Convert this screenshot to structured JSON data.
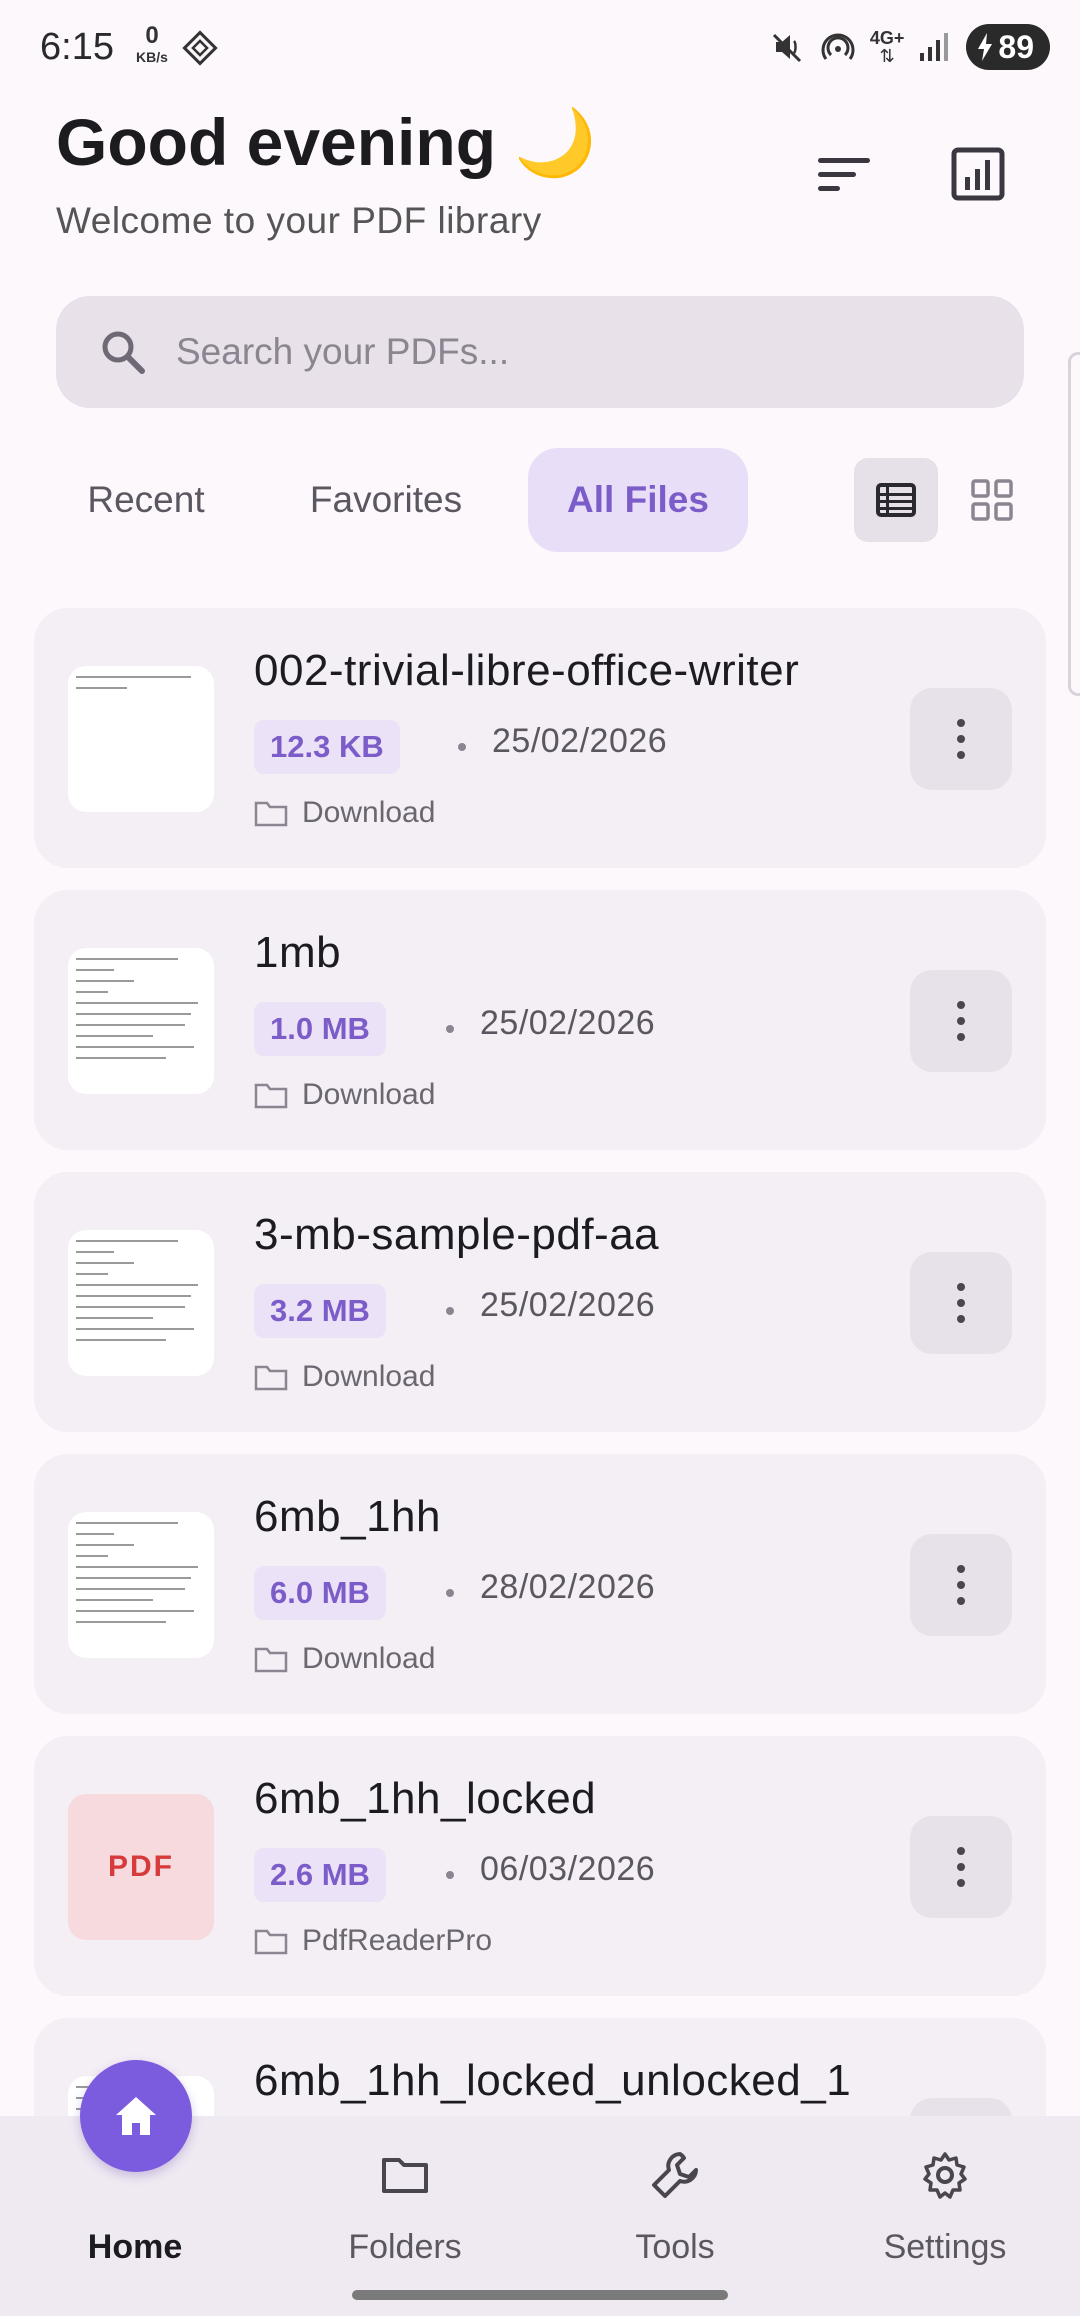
{
  "status_bar": {
    "time": "6:15",
    "net_speed_value": "0",
    "net_speed_unit": "KB/s",
    "network": "4G+",
    "battery": "89"
  },
  "header": {
    "greeting": "Good evening 🌙",
    "subtitle": "Welcome to your PDF library"
  },
  "search": {
    "placeholder": "Search your PDFs..."
  },
  "tabs": [
    {
      "label": "Recent"
    },
    {
      "label": "Favorites"
    },
    {
      "label": "All Files",
      "active": true
    }
  ],
  "files": [
    {
      "name": "002-trivial-libre-office-writer",
      "size": "12.3 KB",
      "date": "25/02/2026",
      "folder": "Download",
      "thumb": "blank"
    },
    {
      "name": "1mb",
      "size": "1.0 MB",
      "date": "25/02/2026",
      "folder": "Download",
      "thumb": "text"
    },
    {
      "name": "3-mb-sample-pdf-aa",
      "size": "3.2 MB",
      "date": "25/02/2026",
      "folder": "Download",
      "thumb": "text"
    },
    {
      "name": "6mb_1hh",
      "size": "6.0 MB",
      "date": "28/02/2026",
      "folder": "Download",
      "thumb": "text"
    },
    {
      "name": "6mb_1hh_locked",
      "size": "2.6 MB",
      "date": "06/03/2026",
      "folder": "PdfReaderPro",
      "thumb": "pdf",
      "thumb_label": "PDF"
    },
    {
      "name": "6mb_1hh_locked_unlocked_1",
      "thumb": "text"
    }
  ],
  "bottom_nav": [
    {
      "label": "Home",
      "icon": "home-icon",
      "active": true
    },
    {
      "label": "Folders",
      "icon": "folder-icon"
    },
    {
      "label": "Tools",
      "icon": "wrench-icon"
    },
    {
      "label": "Settings",
      "icon": "gear-icon"
    }
  ],
  "colors": {
    "accent": "#7b5cde",
    "accent_text": "#7b5cc8",
    "card_bg": "#f4eef5",
    "pdf_thumb_bg": "#f7dadd",
    "pdf_thumb_text": "#d63a3a"
  }
}
